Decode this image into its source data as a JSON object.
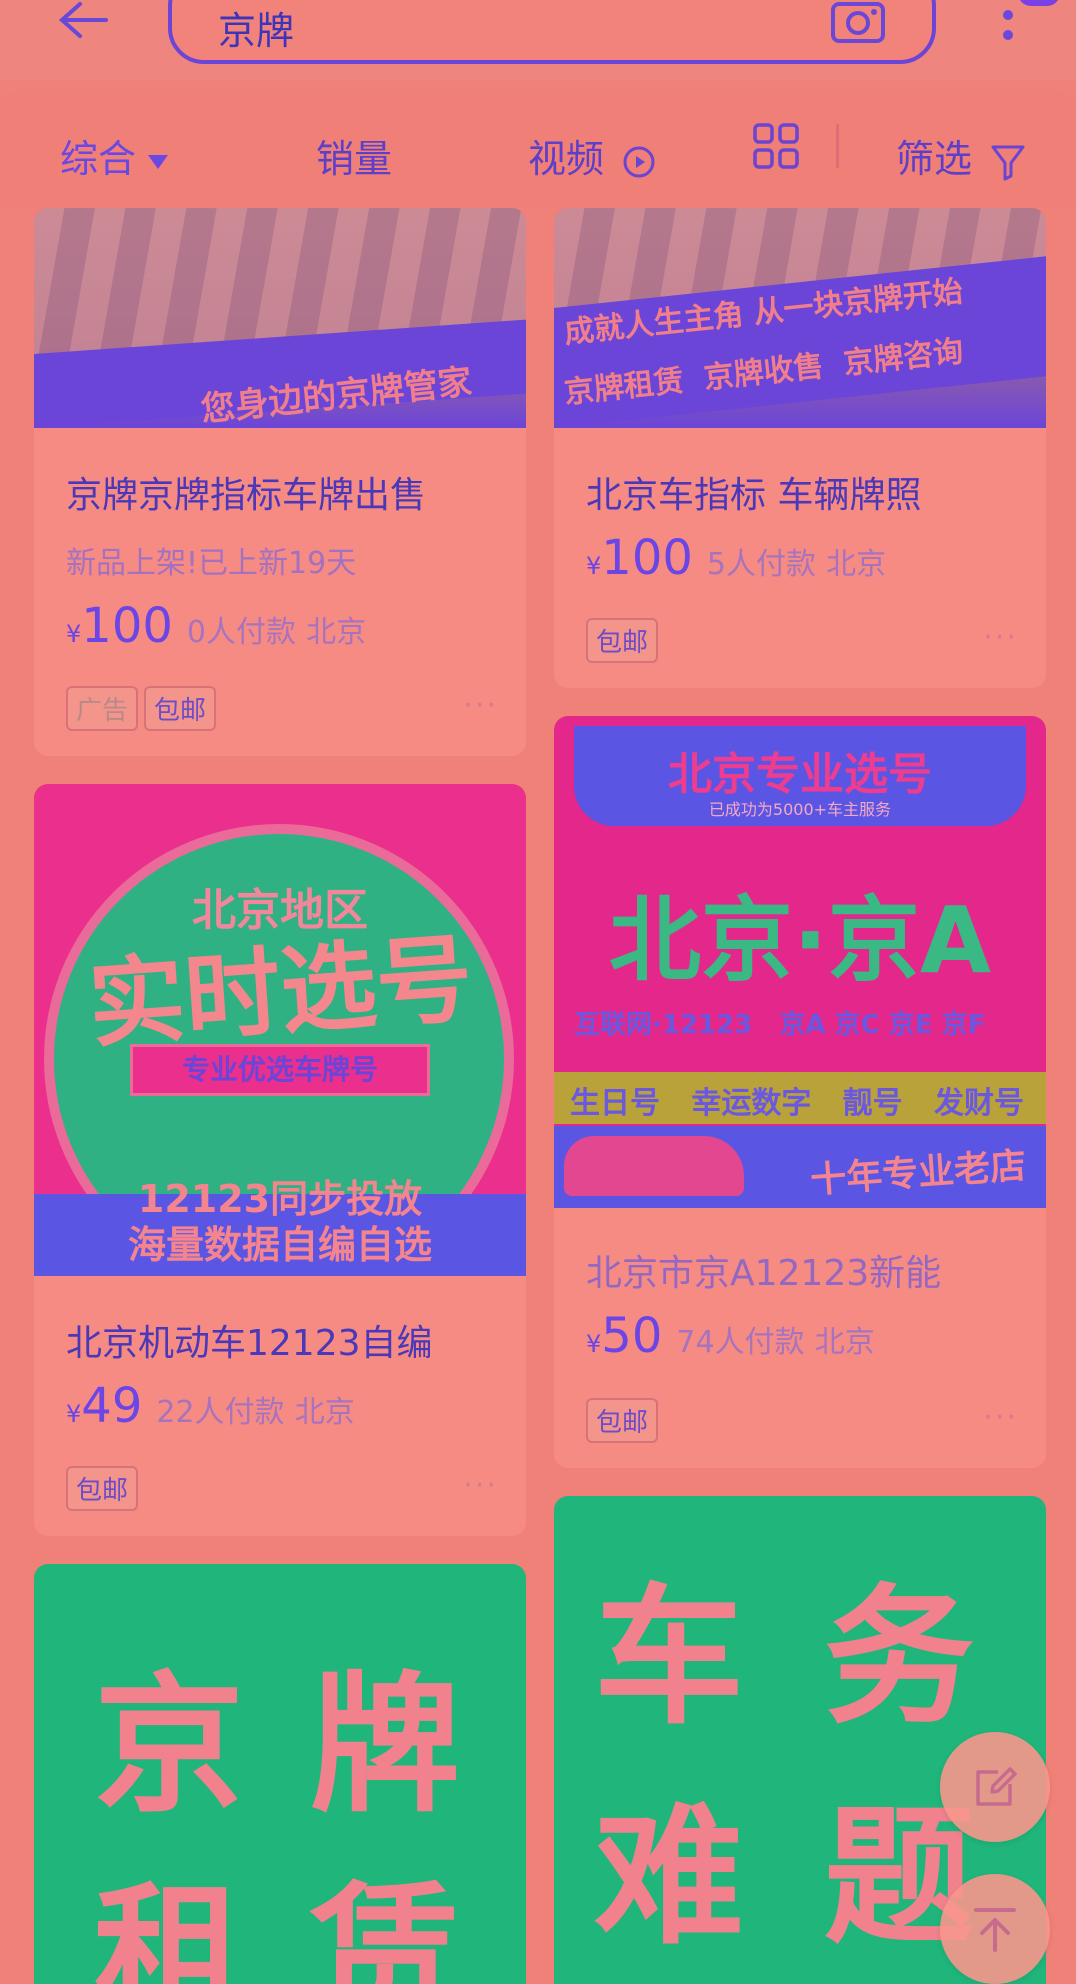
{
  "search": {
    "query": "京牌"
  },
  "filters": {
    "comprehensive": "综合",
    "sales": "销量",
    "video": "视频",
    "filter": "筛选"
  },
  "cards": [
    {
      "banner_line1": "您身边的京牌管家",
      "title": "京牌京牌指标车牌出售",
      "subtitle": "新品上架!已上新19天",
      "yen": "¥",
      "price": "100",
      "buyers": "0人付款",
      "location": "北京",
      "tags": [
        "广告",
        "包邮"
      ],
      "more": "···"
    },
    {
      "banner_line1": "成就人生主角 从一块京牌开始",
      "banner_line2": "京牌租赁 京牌收售 京牌咨询",
      "title": "北京车指标 车辆牌照",
      "yen": "¥",
      "price": "100",
      "buyers": "5人付款",
      "location": "北京",
      "tags": [
        "包邮"
      ],
      "more": "···"
    },
    {
      "img_line1": "北京地区",
      "img_line2": "实时选号",
      "img_line3": "专业优选车牌号",
      "img_line4": "12123同步投放",
      "img_line5": "海量数据自编自选",
      "title": "北京机动车12123自编",
      "yen": "¥",
      "price": "49",
      "buyers": "22人付款",
      "location": "北京",
      "tags": [
        "包邮"
      ],
      "more": "···"
    },
    {
      "img_top": "北京专业选号",
      "img_top_sub": "已成功为5000+车主服务",
      "img_main": "北京·京A",
      "img_row": "互联网·12123   京A 京C 京E 京F",
      "img_band": "生日号   幸运数字   靓号   发财号",
      "img_footer": "十年专业老店",
      "title": "北京市京A12123新能",
      "yen": "¥",
      "price": "50",
      "buyers": "74人付款",
      "location": "北京",
      "tags": [
        "包邮"
      ],
      "more": "···"
    },
    {
      "chars": [
        "京",
        "牌",
        "租",
        "赁"
      ]
    },
    {
      "chars": [
        "车",
        "务",
        "难",
        "题"
      ]
    }
  ]
}
